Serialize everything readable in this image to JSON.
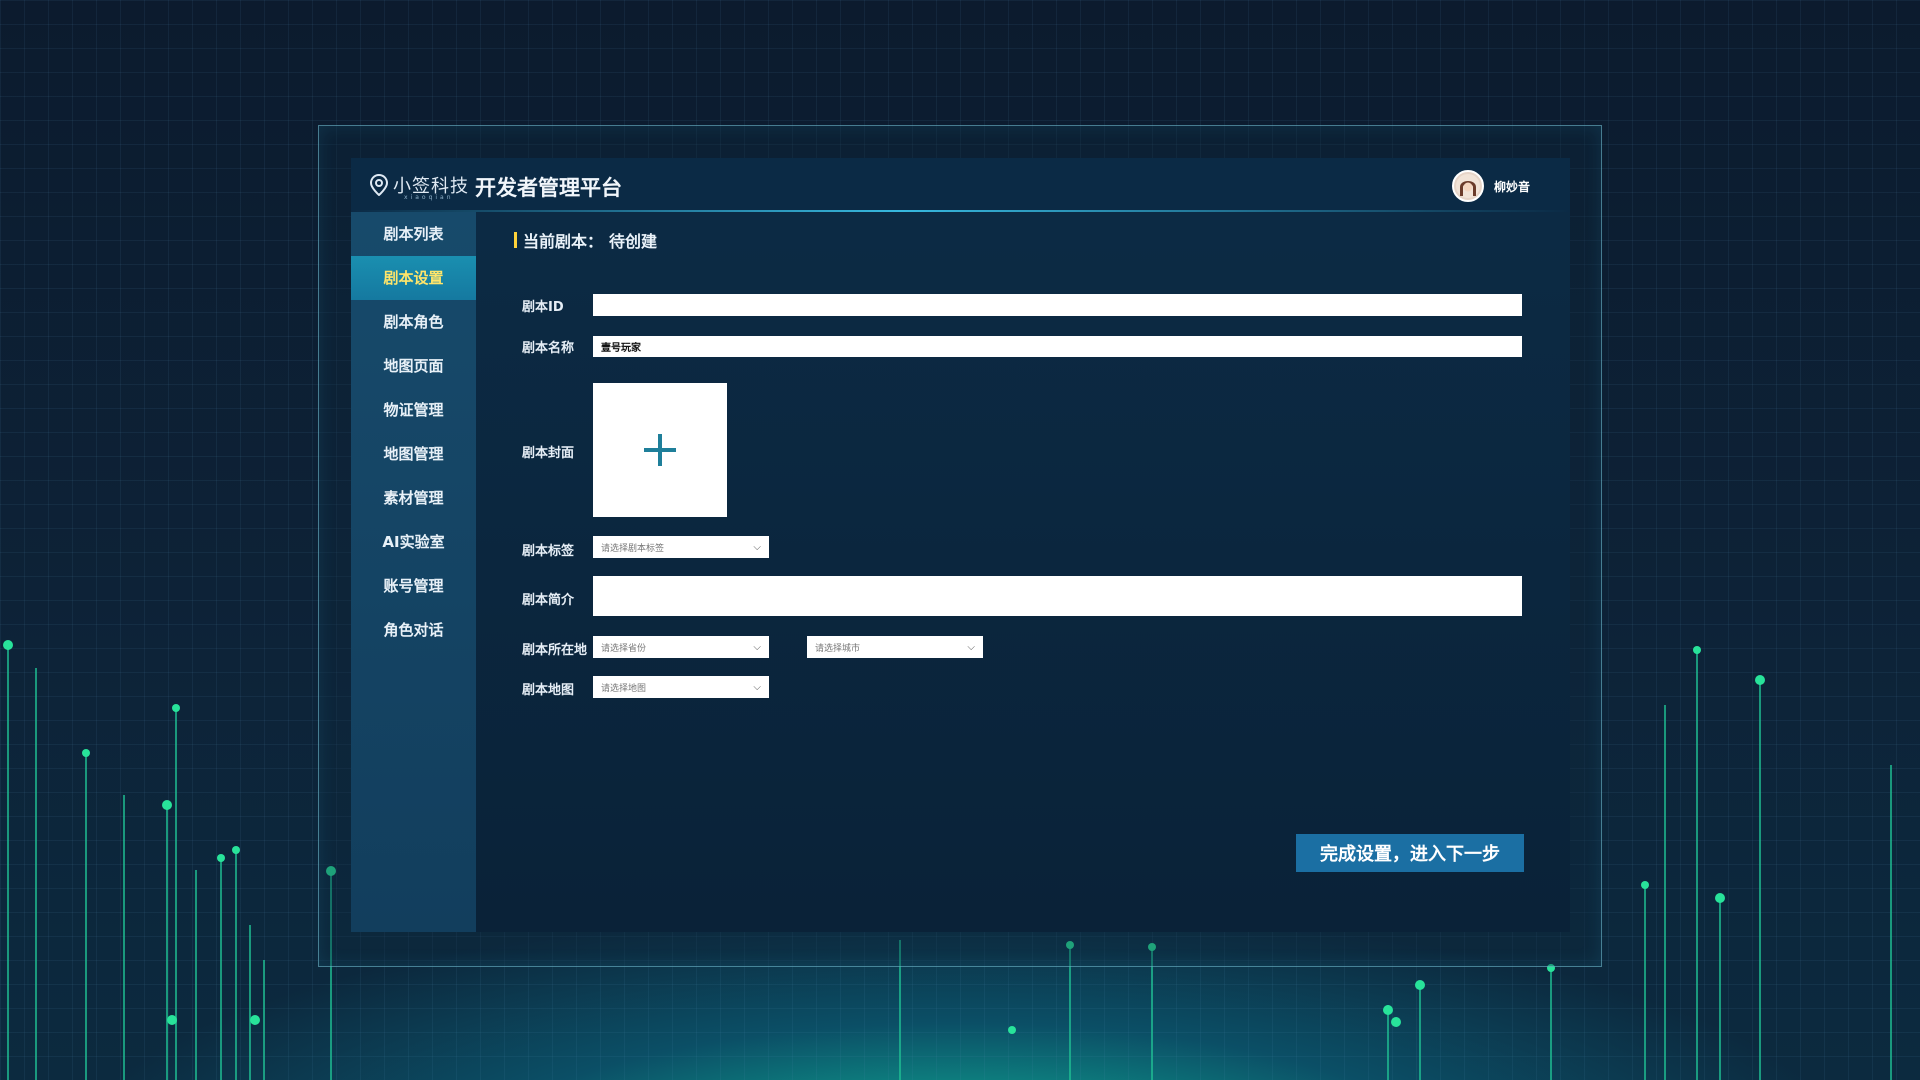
{
  "header": {
    "logo_text": "小签科技",
    "logo_sub": "xiaoqian",
    "title": "开发者管理平台",
    "user_name": "柳妙音"
  },
  "sidebar": {
    "items": [
      {
        "label": "剧本列表"
      },
      {
        "label": "剧本设置",
        "active": true
      },
      {
        "label": "剧本角色"
      },
      {
        "label": "地图页面"
      },
      {
        "label": "物证管理"
      },
      {
        "label": "地图管理"
      },
      {
        "label": "素材管理"
      },
      {
        "label": "AI实验室"
      },
      {
        "label": "账号管理"
      },
      {
        "label": "角色对话"
      }
    ]
  },
  "main": {
    "current_label": "当前剧本：",
    "current_value": "待创建",
    "form": {
      "id_label": "剧本ID",
      "id_value": "",
      "name_label": "剧本名称",
      "name_value": "壹号玩家",
      "cover_label": "剧本封面",
      "tag_label": "剧本标签",
      "tag_placeholder": "请选择剧本标签",
      "intro_label": "剧本简介",
      "intro_value": "",
      "location_label": "剧本所在地",
      "province_placeholder": "请选择省份",
      "city_placeholder": "请选择城市",
      "map_label": "剧本地图",
      "map_placeholder": "请选择地图"
    },
    "next_button": "完成设置，进入下一步"
  },
  "colors": {
    "accent": "#1b6fa3",
    "active_nav": "#1a8fb0",
    "active_text": "#ffe56a",
    "marker": "#ffd23a"
  },
  "icons": {
    "logo": "location-pin-icon",
    "upload": "plus-icon",
    "dropdown": "chevron-down-icon"
  }
}
